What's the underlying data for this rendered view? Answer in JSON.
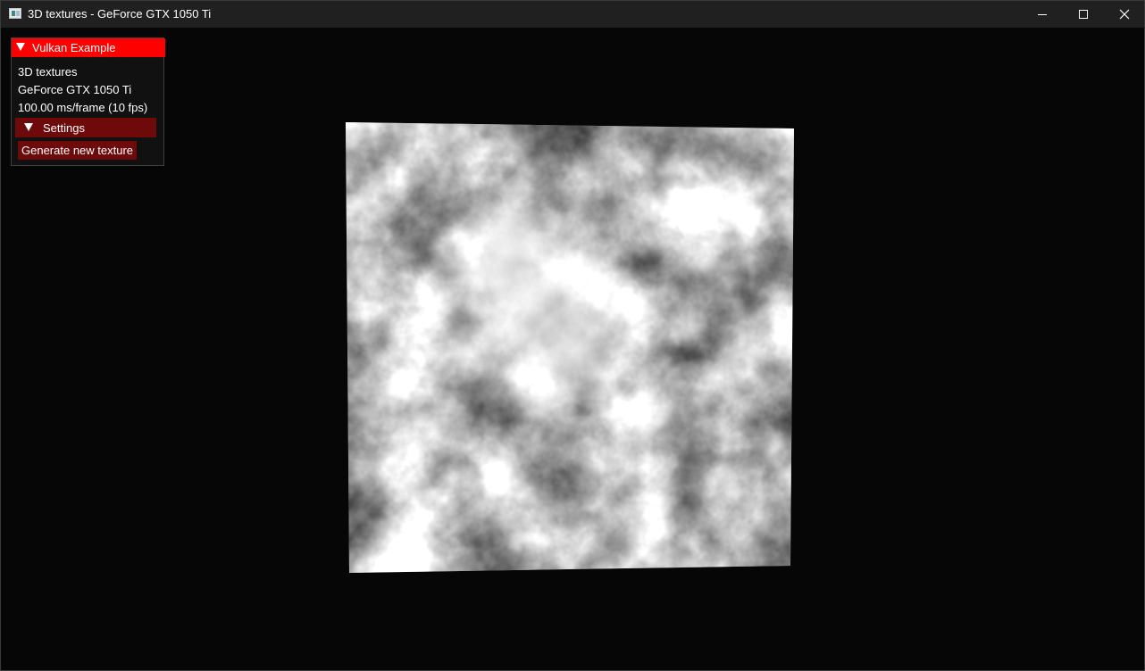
{
  "window": {
    "title": "3D textures - GeForce GTX 1050 Ti"
  },
  "titlebar_buttons": {
    "minimize_icon": "minimize-icon",
    "maximize_icon": "maximize-icon",
    "close_icon": "close-icon"
  },
  "overlay": {
    "title": "Vulkan Example",
    "example_name": "3D textures",
    "device_name": "GeForce GTX 1050 Ti",
    "frame_stats": "100.00 ms/frame (10 fps)",
    "settings_header": "Settings",
    "generate_button": "Generate new texture",
    "colors": {
      "title_bg": "#ff0000",
      "header_bg": "#6e0a0a",
      "button_bg": "#6e0a0a"
    }
  },
  "scene": {
    "content": "noise-texture-quad"
  }
}
